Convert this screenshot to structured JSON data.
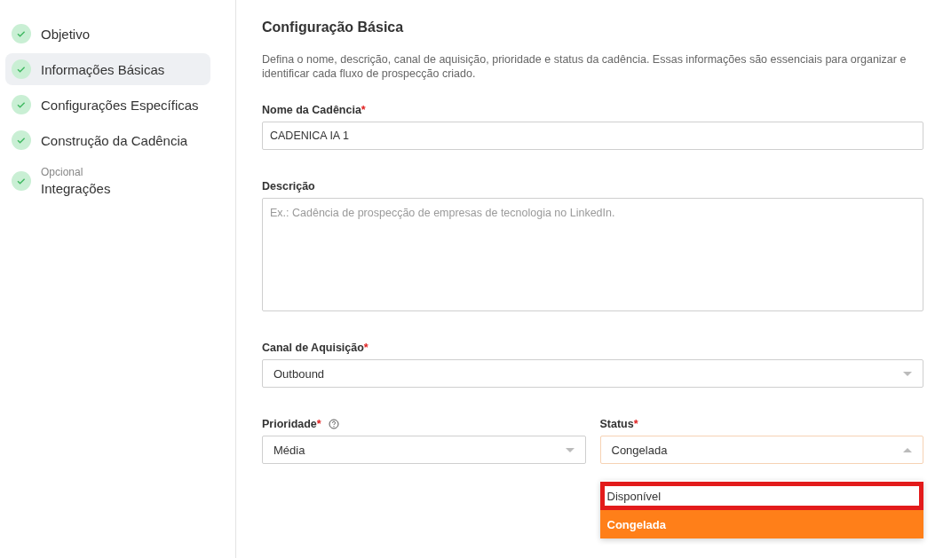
{
  "steps": [
    {
      "label": "Objetivo",
      "done": true,
      "selected": false
    },
    {
      "label": "Informações Básicas",
      "done": true,
      "selected": true
    },
    {
      "label": "Configurações Específicas",
      "done": true,
      "selected": false
    },
    {
      "label": "Construção da Cadência",
      "done": true,
      "selected": false
    },
    {
      "caption": "Opcional",
      "label": "Integrações",
      "done": true,
      "selected": false
    }
  ],
  "section": {
    "title": "Configuração Básica",
    "description": "Defina o nome, descrição, canal de aquisição, prioridade e status da cadência. Essas informações são essenciais para organizar e identificar cada fluxo de prospecção criado."
  },
  "fields": [
    {
      "kind": "text",
      "label": "Nome da Cadência",
      "required_mark": "*",
      "value": "CADENICA IA 1"
    },
    {
      "kind": "textarea",
      "label": "Descrição",
      "placeholder": "Ex.: Cadência de prospecção de empresas de tecnologia no LinkedIn."
    },
    {
      "kind": "select",
      "label": "Canal de Aquisição",
      "required_mark": "*",
      "value": "Outbound",
      "expanded": false
    }
  ],
  "row": [
    {
      "kind": "select",
      "label": "Prioridade",
      "required_mark": "*",
      "help": true,
      "value": "Média",
      "expanded": false
    },
    {
      "kind": "select",
      "label": "Status",
      "required_mark": "*",
      "value": "Congelada",
      "expanded": true,
      "options": [
        {
          "label": "Disponível",
          "selected": false,
          "highlighted": true
        },
        {
          "label": "Congelada",
          "selected": true,
          "highlighted": false
        }
      ]
    }
  ]
}
